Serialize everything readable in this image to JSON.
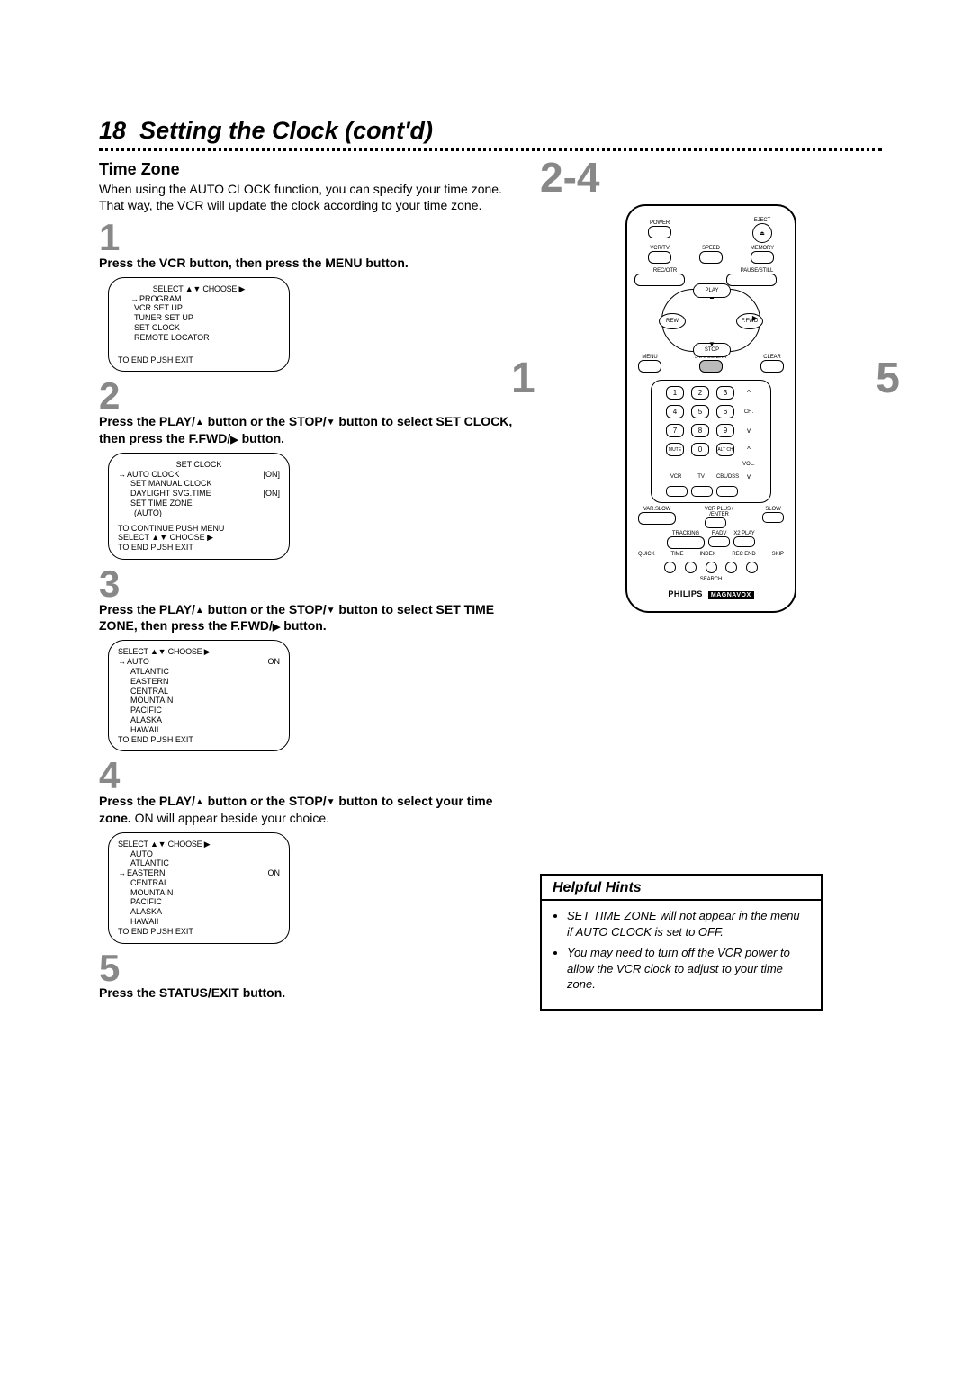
{
  "header": {
    "page_number": "18",
    "title": "Setting the Clock (cont'd)"
  },
  "section": {
    "heading": "Time Zone",
    "intro": "When using the AUTO CLOCK function, you can specify your time zone. That way, the VCR will update the clock according to your time zone."
  },
  "callouts": {
    "range": "2-4",
    "left": "1",
    "right": "5"
  },
  "steps": {
    "1": {
      "num": "1",
      "text_a": "Press the VCR button, then press the MENU button."
    },
    "2": {
      "num": "2",
      "text_a": "Press the PLAY/",
      "text_b": " button or the STOP/",
      "text_c": " button to select SET CLOCK, then press the F.FWD/",
      "text_d": " button."
    },
    "3": {
      "num": "3",
      "text_a": "Press the PLAY/",
      "text_b": " button or the STOP/",
      "text_c": " button to select SET TIME ZONE, then press the F.FWD/",
      "text_d": " button."
    },
    "4": {
      "num": "4",
      "text_a": "Press the PLAY/",
      "text_b": " button or the STOP/",
      "text_c": " button to select your time zone.",
      "text_d": " ON will appear beside your choice."
    },
    "5": {
      "num": "5",
      "text_a": "Press the STATUS/EXIT button."
    }
  },
  "screen1": {
    "head": "SELECT ▲▼ CHOOSE ▶",
    "l1": "PROGRAM",
    "l2": "VCR SET UP",
    "l3": "TUNER SET UP",
    "l4": "SET CLOCK",
    "l5": "REMOTE LOCATOR",
    "foot": "TO END PUSH EXIT"
  },
  "screen2": {
    "head": "SET CLOCK",
    "r1a": "AUTO CLOCK",
    "r1b": "[ON]",
    "r2a": "SET MANUAL CLOCK",
    "r3a": "DAYLIGHT SVG.TIME",
    "r3b": "[ON]",
    "r4a": "SET TIME ZONE",
    "r5a": "(AUTO)",
    "f1": "TO CONTINUE PUSH MENU",
    "f2": "SELECT ▲▼ CHOOSE ▶",
    "f3": "TO END PUSH EXIT"
  },
  "screen3": {
    "head": "SELECT ▲▼ CHOOSE ▶",
    "l1": "AUTO",
    "l1b": "ON",
    "l2": "ATLANTIC",
    "l3": "EASTERN",
    "l4": "CENTRAL",
    "l5": "MOUNTAIN",
    "l6": "PACIFIC",
    "l7": "ALASKA",
    "l8": "HAWAII",
    "foot": "TO END PUSH EXIT"
  },
  "screen4": {
    "head": "SELECT ▲▼ CHOOSE ▶",
    "l1": "AUTO",
    "l2": "ATLANTIC",
    "l3": "EASTERN",
    "l3b": "ON",
    "l4": "CENTRAL",
    "l5": "MOUNTAIN",
    "l6": "PACIFIC",
    "l7": "ALASKA",
    "l8": "HAWAII",
    "foot": "TO END PUSH EXIT"
  },
  "remote": {
    "power": "POWER",
    "eject": "EJECT",
    "vcrtv": "VCR/TV",
    "speed": "SPEED",
    "memory": "MEMORY",
    "recotr": "REC/OTR",
    "pausestill": "PAUSE/STILL",
    "play": "PLAY",
    "stop": "STOP",
    "rew": "REW",
    "ffwd": "F.FWD",
    "menu": "MENU",
    "status": "STATUS/EXIT",
    "clear": "CLEAR",
    "ch": "CH.",
    "vol": "VOL.",
    "mute": "MUTE",
    "altch": "ALT CH",
    "n1": "1",
    "n2": "2",
    "n3": "3",
    "n4": "4",
    "n5": "5",
    "n6": "6",
    "n7": "7",
    "n8": "8",
    "n9": "9",
    "n0": "0",
    "vcr": "VCR",
    "tv": "TV",
    "cbl": "CBL/DSS",
    "varslow": "VAR.SLOW",
    "vcrplus": "VCR PLUS+\n/ENTER",
    "slow2": "SLOW",
    "tracking": "TRACKING",
    "fadv": "F.ADV",
    "x2": "X2 PLAY",
    "quick": "QUICK",
    "time": "TIME",
    "index": "INDEX",
    "recend": "REC END",
    "skip": "SKIP",
    "search": "SEARCH",
    "brand": "PHILIPS",
    "brand_sub": "MAGNAVOX"
  },
  "hints": {
    "title": "Helpful Hints",
    "items": [
      "SET TIME ZONE will not appear in the menu if AUTO CLOCK is set to OFF.",
      "You may need to turn off the VCR power to allow the VCR clock to adjust to your time zone."
    ]
  }
}
